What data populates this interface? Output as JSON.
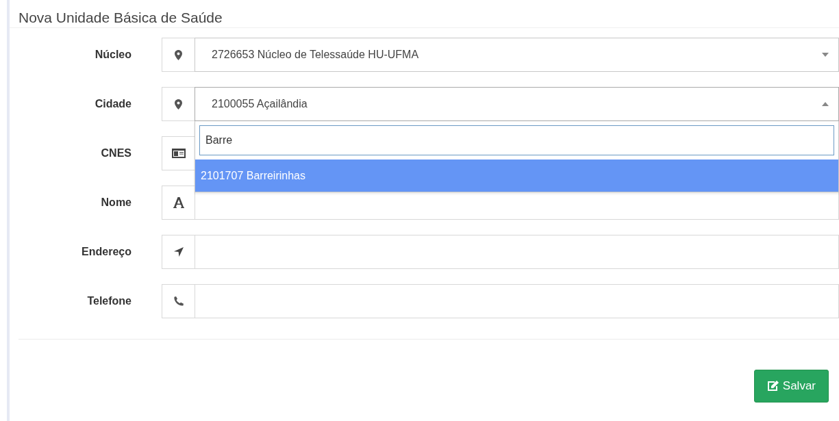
{
  "title": "Nova Unidade Básica de Saúde",
  "fields": [
    {
      "label": "Núcleo",
      "kind": "select",
      "value": "2726653 Núcleo de Telessaúde HU-UFMA",
      "expanded": false
    },
    {
      "label": "Cidade",
      "kind": "select",
      "value": "2100055 Açailândia",
      "expanded": true,
      "dropdown": {
        "search": "Barre",
        "options": [
          {
            "label": "2101707 Barreirinhas",
            "selected": true
          }
        ]
      }
    },
    {
      "label": "CNES",
      "kind": "text"
    },
    {
      "label": "Nome",
      "kind": "text"
    },
    {
      "label": "Endereço",
      "kind": "text"
    },
    {
      "label": "Telefone",
      "kind": "text"
    }
  ],
  "save_button": {
    "label": "Salvar"
  }
}
